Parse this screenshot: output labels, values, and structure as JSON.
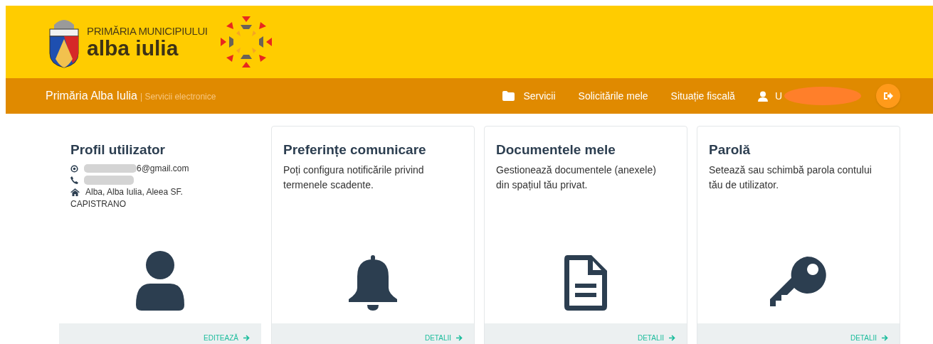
{
  "header": {
    "logo_line_1": "PRIMĂRIA MUNICIPIULUI",
    "logo_line_2": "alba iulia"
  },
  "navbar": {
    "brand": "Primăria Alba Iulia",
    "subtitle": "| Servicii electronice",
    "links": [
      {
        "label": "Servicii",
        "kind": "folder"
      },
      {
        "label": "Solicitările mele",
        "kind": "plain"
      },
      {
        "label": "Situație fiscală",
        "kind": "plain"
      }
    ],
    "user": "U"
  },
  "cards": [
    {
      "kind": "profile",
      "title": "Profil utilizator",
      "email": "6@gmail.com",
      "address_1": "Alba, Alba Iulia, Aleea SF.",
      "address_2": "CAPISTRANO",
      "action": "EDITEAZĂ"
    },
    {
      "kind": "text",
      "title": "Preferințe comunicare",
      "description": "Poți configura notificările privind termenele scadente.",
      "action": "DETALII"
    },
    {
      "kind": "text",
      "title": "Documentele mele",
      "description": "Gestionează documentele (anexele) din spațiul tău privat.",
      "action": "DETALII"
    },
    {
      "kind": "text",
      "title": "Parolă",
      "description": "Setează sau schimbă parola contului tău de utilizator.",
      "action": "DETALII"
    }
  ]
}
